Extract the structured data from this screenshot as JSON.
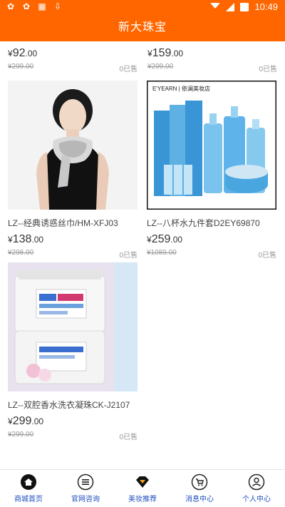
{
  "status_bar": {
    "time": "10:49"
  },
  "header": {
    "title": "新大珠宝"
  },
  "top_row": [
    {
      "price_int": "92",
      "price_dec": ".00",
      "orig": "¥299.00",
      "sold": "0已售"
    },
    {
      "price_int": "159",
      "price_dec": ".00",
      "orig": "¥299.00",
      "sold": "0已售"
    }
  ],
  "products": [
    {
      "title": "LZ--经典诱惑丝巾/HM-XFJ03",
      "price_int": "138",
      "price_dec": ".00",
      "orig": "¥298.00",
      "sold": "0已售",
      "brand": ""
    },
    {
      "title": "LZ--八杯水九件套D2EY69870",
      "price_int": "259",
      "price_dec": ".00",
      "orig": "¥1089.00",
      "sold": "0已售",
      "brand": "E'YEARN | 依澜美妆店"
    },
    {
      "title": "LZ--双腔香水洗衣凝珠CK-J2107",
      "price_int": "299",
      "price_dec": ".00",
      "orig": "¥299.00",
      "sold": "0已售",
      "brand": ""
    }
  ],
  "currency": "¥",
  "tabbar": {
    "items": [
      {
        "label": "商城首页",
        "icon": "home-icon"
      },
      {
        "label": "官网咨询",
        "icon": "menu-list-icon"
      },
      {
        "label": "美妆推荐",
        "icon": "diamond-icon"
      },
      {
        "label": "消息中心",
        "icon": "cart-icon"
      },
      {
        "label": "个人中心",
        "icon": "user-icon"
      }
    ]
  },
  "colors": {
    "accent": "#ff6600",
    "tab_label": "#1f4fbf",
    "muted": "#999999"
  }
}
